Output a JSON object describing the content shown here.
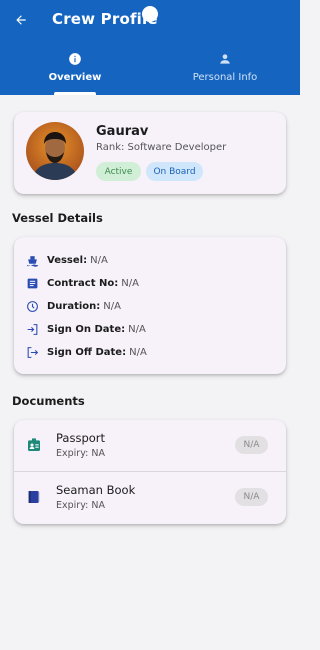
{
  "header": {
    "title": "Crew Profile",
    "bg_color": "#1565c0"
  },
  "tabs": [
    {
      "label": "Overview",
      "icon": "info-icon",
      "active": true
    },
    {
      "label": "Personal Info",
      "icon": "person-icon",
      "active": false
    }
  ],
  "profile": {
    "name": "Gaurav",
    "rank": "Rank: Software Developer",
    "badges": [
      {
        "label": "Active",
        "color": "#3d8c4f"
      },
      {
        "label": "On Board",
        "color": "#1c63b8"
      }
    ]
  },
  "vessel_details": {
    "title": "Vessel Details",
    "rows": [
      {
        "label": "Vessel:",
        "value": "N/A",
        "icon": "ship-icon"
      },
      {
        "label": "Contract No:",
        "value": "N/A",
        "icon": "document-icon"
      },
      {
        "label": "Duration:",
        "value": "N/A",
        "icon": "clock-icon"
      },
      {
        "label": "Sign On Date:",
        "value": "N/A",
        "icon": "login-icon"
      },
      {
        "label": "Sign Off Date:",
        "value": "N/A",
        "icon": "logout-icon"
      }
    ]
  },
  "documents": {
    "title": "Documents",
    "items": [
      {
        "name": "Passport",
        "expiry": "Expiry: NA",
        "status": "N/A",
        "icon": "badge-icon",
        "icon_color": "#1f8a7a"
      },
      {
        "name": "Seaman Book",
        "expiry": "Expiry: NA",
        "status": "N/A",
        "icon": "book-icon",
        "icon_color": "#2a3f9e"
      }
    ]
  }
}
